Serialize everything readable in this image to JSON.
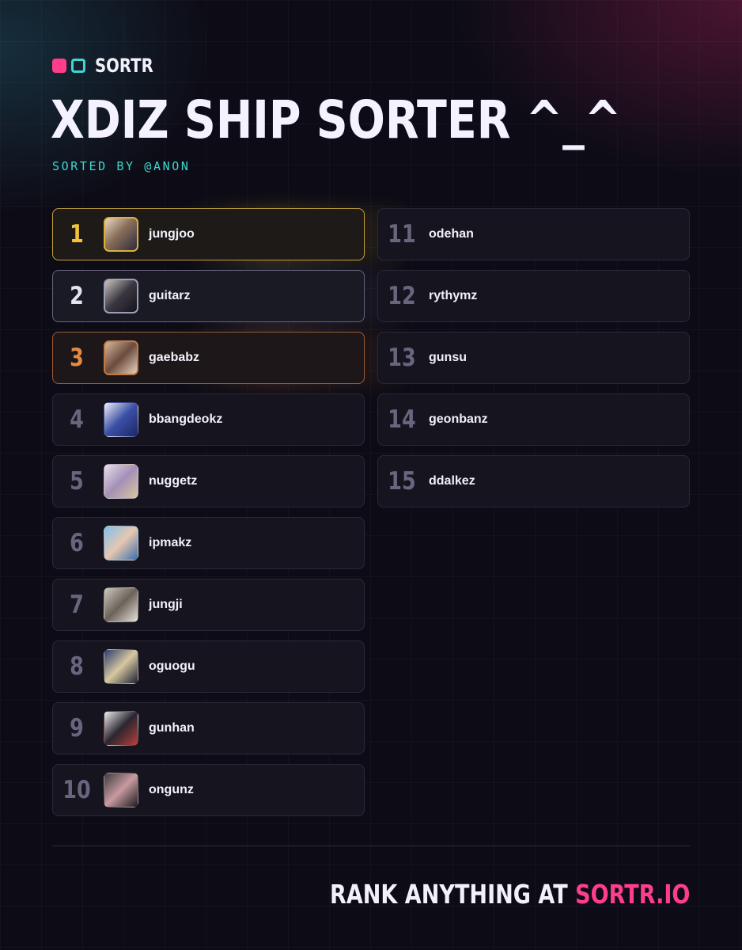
{
  "brand": {
    "name": "SORTR",
    "colors": {
      "pink": "#ff3d8b",
      "teal": "#3fd6d2"
    }
  },
  "header": {
    "title": "XDIZ SHIP SORTER ^_^",
    "subtitle": "SORTED BY @ANON"
  },
  "ranking": [
    {
      "rank": "1",
      "name": "jungjoo"
    },
    {
      "rank": "2",
      "name": "guitarz"
    },
    {
      "rank": "3",
      "name": "gaebabz"
    },
    {
      "rank": "4",
      "name": "bbangdeokz"
    },
    {
      "rank": "5",
      "name": "nuggetz"
    },
    {
      "rank": "6",
      "name": "ipmakz"
    },
    {
      "rank": "7",
      "name": "jungji"
    },
    {
      "rank": "8",
      "name": "oguogu"
    },
    {
      "rank": "9",
      "name": "gunhan"
    },
    {
      "rank": "10",
      "name": "ongunz"
    },
    {
      "rank": "11",
      "name": "odehan"
    },
    {
      "rank": "12",
      "name": "rythymz"
    },
    {
      "rank": "13",
      "name": "gunsu"
    },
    {
      "rank": "14",
      "name": "geonbanz"
    },
    {
      "rank": "15",
      "name": "ddalkez"
    }
  ],
  "footer": {
    "text": "RANK ANYTHING AT ",
    "link": "SORTR.IO"
  }
}
